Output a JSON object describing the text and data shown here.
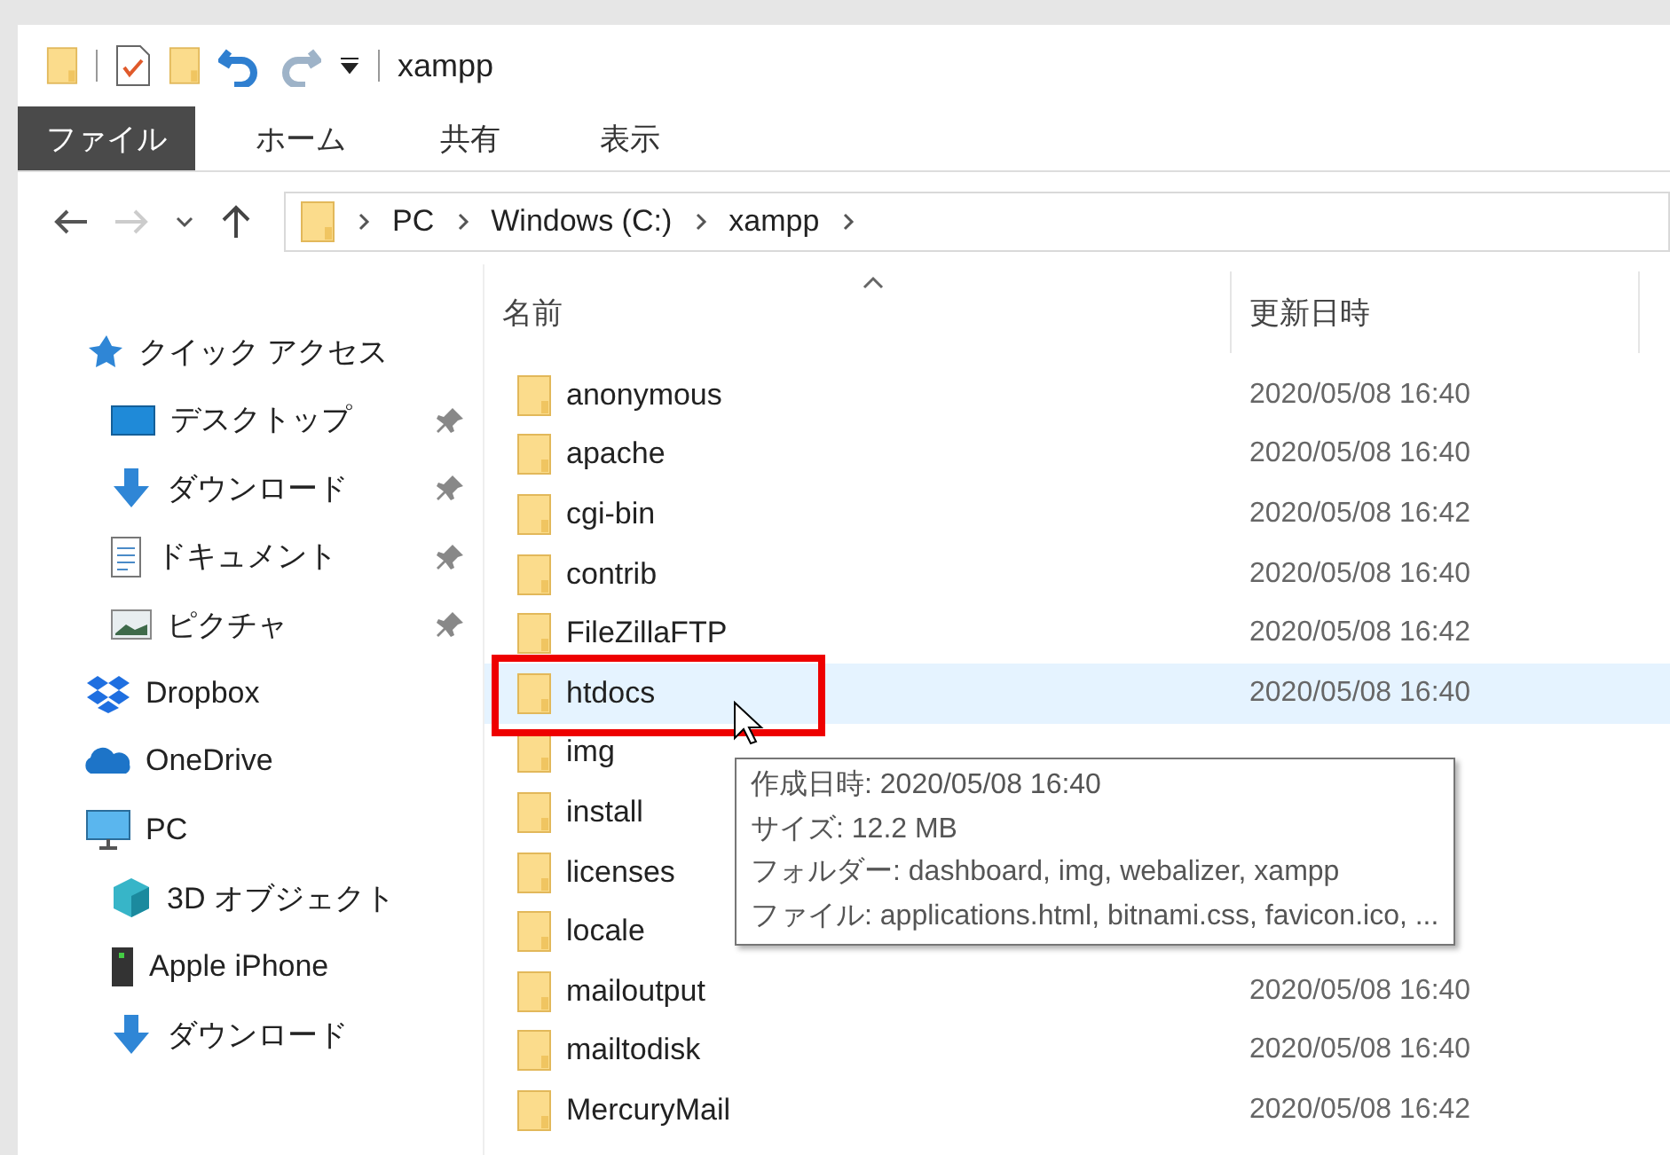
{
  "window": {
    "title": "xampp"
  },
  "ribbon_tabs": [
    {
      "label": "ファイル",
      "selected": true
    },
    {
      "label": "ホーム",
      "selected": false
    },
    {
      "label": "共有",
      "selected": false
    },
    {
      "label": "表示",
      "selected": false
    }
  ],
  "breadcrumb": [
    "PC",
    "Windows (C:)",
    "xampp"
  ],
  "navigation": [
    {
      "label": "クイック アクセス",
      "kind": "star",
      "children": [
        {
          "label": "デスクトップ",
          "kind": "desktop",
          "pinned": true
        },
        {
          "label": "ダウンロード",
          "kind": "download",
          "pinned": true
        },
        {
          "label": "ドキュメント",
          "kind": "document",
          "pinned": true
        },
        {
          "label": "ピクチャ",
          "kind": "pictures",
          "pinned": true
        }
      ]
    },
    {
      "label": "Dropbox",
      "kind": "dropbox"
    },
    {
      "label": "OneDrive",
      "kind": "cloud"
    },
    {
      "label": "PC",
      "kind": "pc",
      "children": [
        {
          "label": "3D オブジェクト",
          "kind": "cube",
          "pinned": false
        },
        {
          "label": "Apple iPhone",
          "kind": "phone",
          "pinned": false
        },
        {
          "label": "ダウンロード",
          "kind": "download",
          "pinned": false
        }
      ]
    }
  ],
  "columns": [
    "名前",
    "更新日時"
  ],
  "files": [
    {
      "name": "anonymous",
      "modified": "2020/05/08 16:40",
      "selected": false
    },
    {
      "name": "apache",
      "modified": "2020/05/08 16:40",
      "selected": false
    },
    {
      "name": "cgi-bin",
      "modified": "2020/05/08 16:42",
      "selected": false
    },
    {
      "name": "contrib",
      "modified": "2020/05/08 16:40",
      "selected": false
    },
    {
      "name": "FileZillaFTP",
      "modified": "2020/05/08 16:42",
      "selected": false
    },
    {
      "name": "htdocs",
      "modified": "2020/05/08 16:40",
      "selected": true
    },
    {
      "name": "img",
      "selected": false
    },
    {
      "name": "install",
      "selected": false
    },
    {
      "name": "licenses",
      "selected": false
    },
    {
      "name": "locale",
      "selected": false
    },
    {
      "name": "mailoutput",
      "modified": "2020/05/08 16:40",
      "selected": false
    },
    {
      "name": "mailtodisk",
      "modified": "2020/05/08 16:40",
      "selected": false
    },
    {
      "name": "MercuryMail",
      "modified": "2020/05/08 16:42",
      "selected": false
    }
  ],
  "tooltip": [
    "作成日時: 2020/05/08 16:40",
    "サイズ: 12.2 MB",
    "フォルダー: dashboard, img, webalizer, xampp",
    "ファイル: applications.html, bitnami.css, favicon.ico, ..."
  ]
}
